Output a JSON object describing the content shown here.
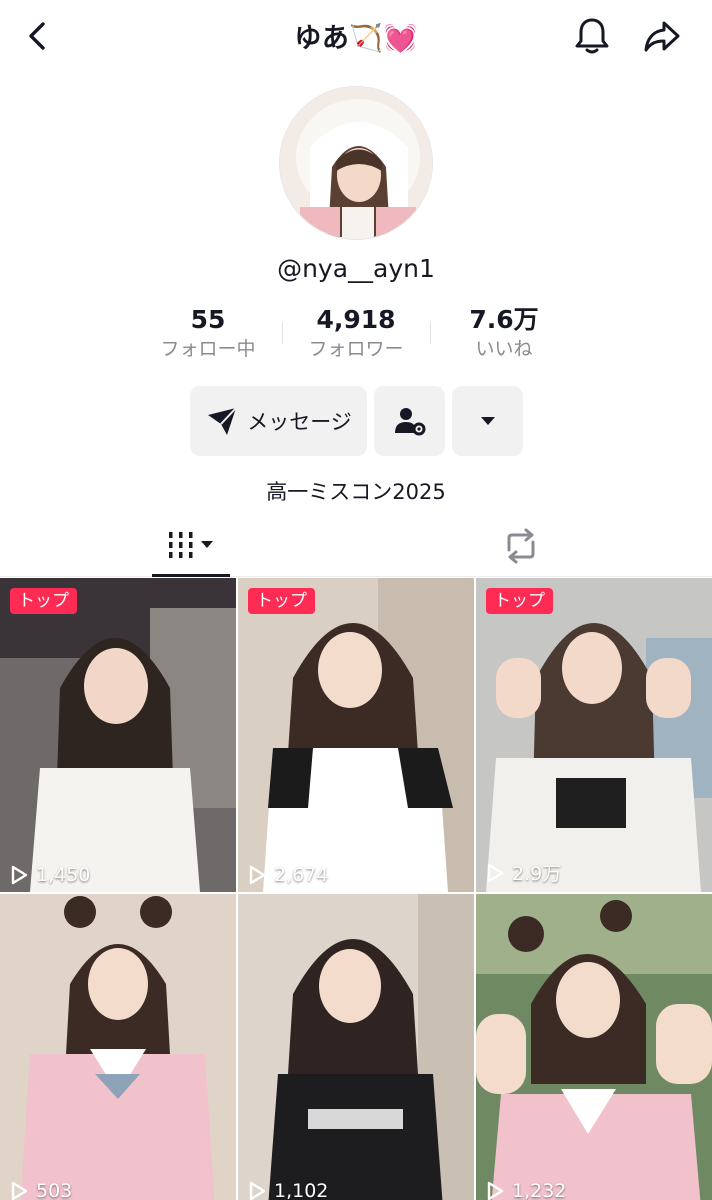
{
  "header": {
    "title": "ゆあ🏹💓",
    "icons": {
      "back": "chevron-left-icon",
      "bell": "bell-icon",
      "share": "share-arrow-icon"
    }
  },
  "profile": {
    "username": "@nya__ayn1",
    "stats": [
      {
        "value": "55",
        "label": "フォロー中"
      },
      {
        "value": "4,918",
        "label": "フォロワー"
      },
      {
        "value": "7.6万",
        "label": "いいね"
      }
    ],
    "message_button": "メッセージ",
    "bio": "高一ミスコン2025"
  },
  "tabs": {
    "videos_icon": "grid-bars-icon",
    "repost_icon": "repost-icon"
  },
  "videos": [
    {
      "badge": "トップ",
      "views": "1,450"
    },
    {
      "badge": "トップ",
      "views": "2,674"
    },
    {
      "badge": "トップ",
      "views": "2.9万"
    },
    {
      "badge": "",
      "views": "503"
    },
    {
      "badge": "",
      "views": "1,102"
    },
    {
      "badge": "",
      "views": "1,232"
    }
  ],
  "colors": {
    "accent": "#fe2c55",
    "text": "#161823",
    "muted": "#8a8b91",
    "button_bg": "#f1f1f2"
  }
}
